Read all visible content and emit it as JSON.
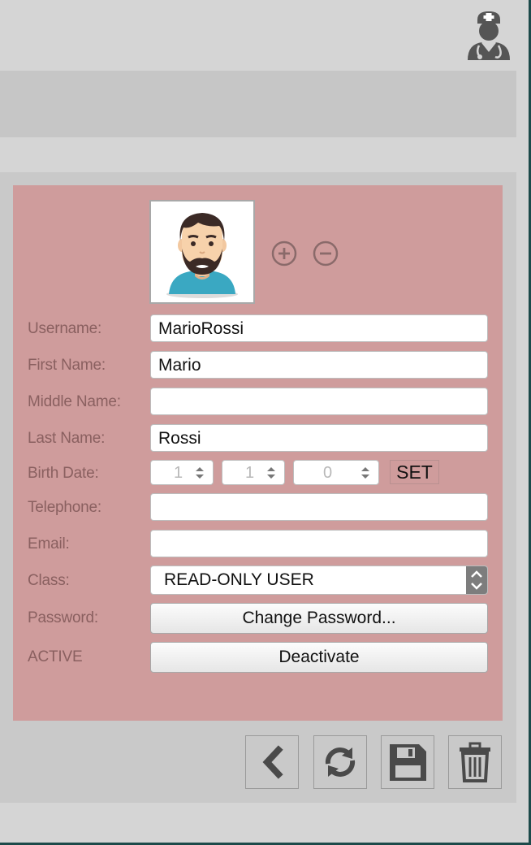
{
  "header": {
    "user_icon": "doctor-avatar-icon"
  },
  "form": {
    "avatar_icon": "bearded-man-avatar",
    "username_label": "Username:",
    "username_value": "MarioRossi",
    "firstname_label": "First Name:",
    "firstname_value": "Mario",
    "middlename_label": "Middle Name:",
    "middlename_value": "",
    "lastname_label": "Last Name:",
    "lastname_value": "Rossi",
    "birthdate_label": "Birth Date:",
    "birth_day": "1",
    "birth_month": "1",
    "birth_year": "0",
    "set_label": "SET",
    "telephone_label": "Telephone:",
    "telephone_value": "",
    "email_label": "Email:",
    "email_value": "",
    "class_label": "Class:",
    "class_value": "READ-ONLY USER",
    "password_label": "Password:",
    "change_password_label": "Change Password...",
    "status_label": "ACTIVE",
    "deactivate_label": "Deactivate"
  },
  "toolbar": {
    "icons": [
      "back-icon",
      "refresh-icon",
      "save-icon",
      "delete-icon"
    ]
  },
  "colors": {
    "form_bg": "#cf9c9c",
    "label": "#8a6060",
    "panel": "#c9c9c9",
    "page": "#d5d5d5"
  }
}
